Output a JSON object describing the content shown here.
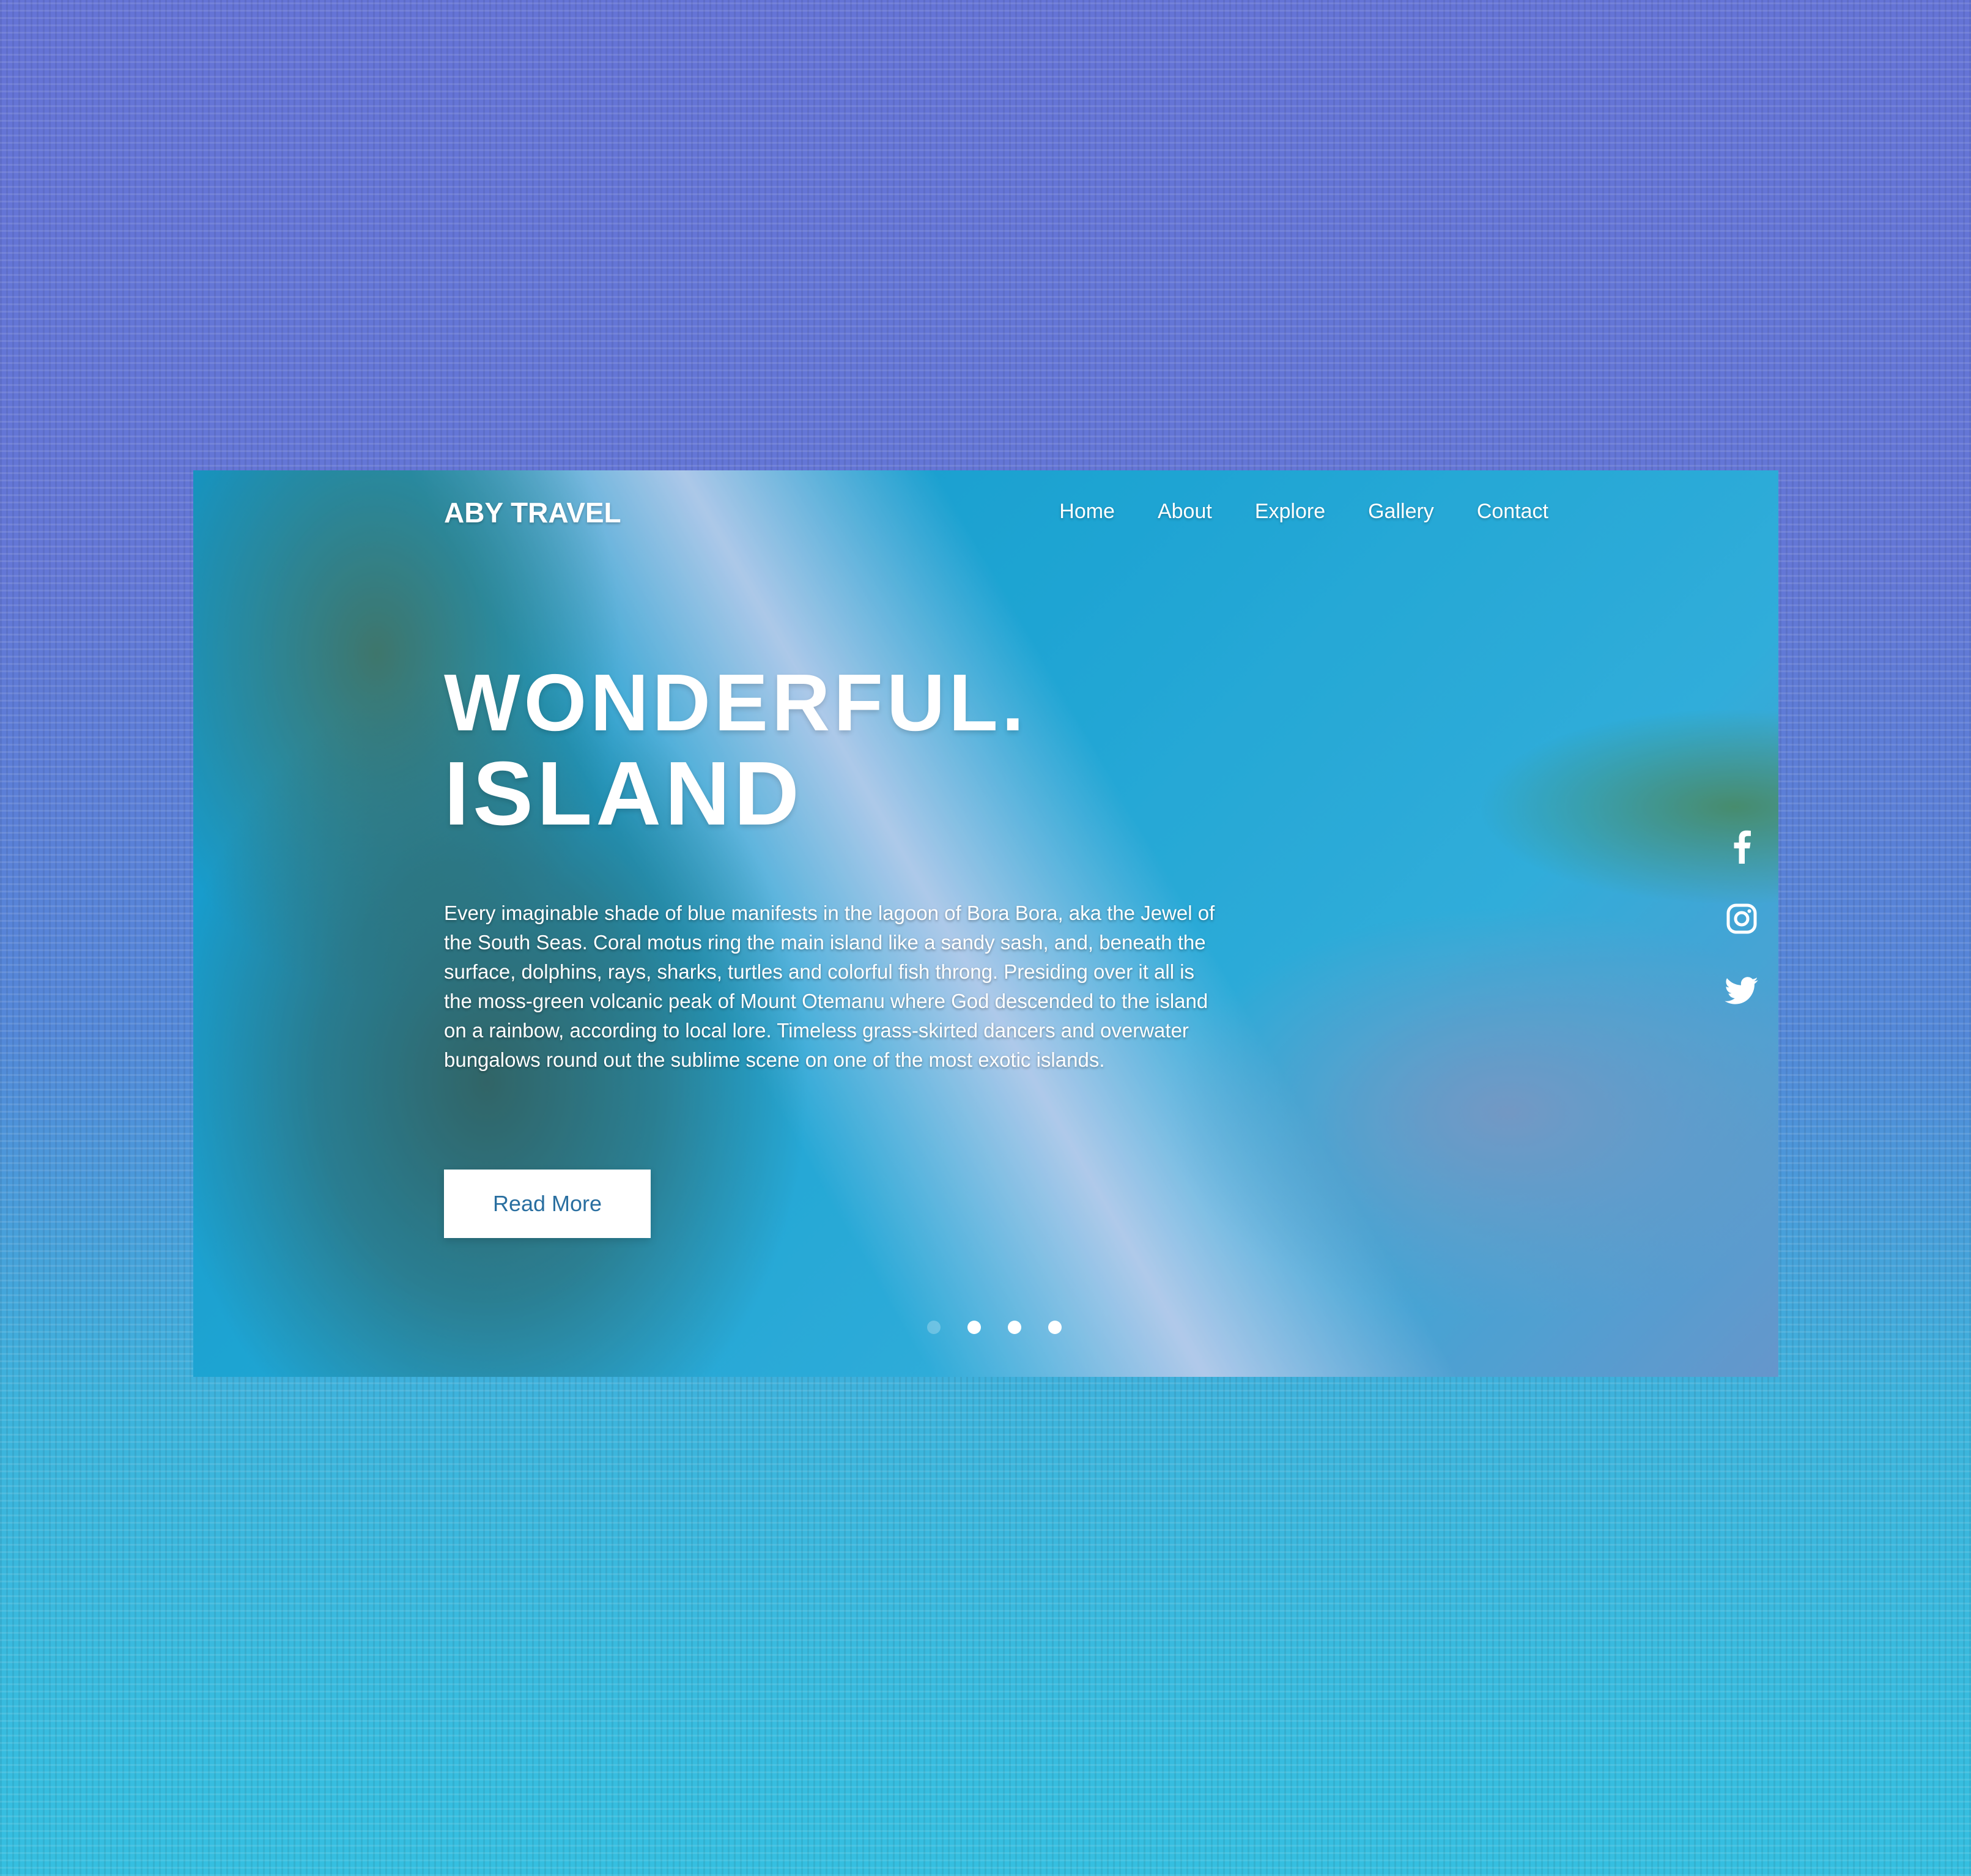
{
  "brand": "ABY TRAVEL",
  "nav": {
    "items": [
      "Home",
      "About",
      "Explore",
      "Gallery",
      "Contact"
    ]
  },
  "hero": {
    "title_line1": "WONDERFUL.",
    "title_line2": "ISLAND",
    "description": "Every imaginable shade of blue manifests in the lagoon of Bora Bora, aka the Jewel of the South Seas. Coral motus ring the main island like a sandy sash, and, beneath the surface, dolphins, rays, sharks, turtles and colorful fish throng. Presiding over it all is the moss-green volcanic peak of Mount Otemanu where God descended to the island on a rainbow, according to local lore. Timeless grass-skirted dancers and overwater bungalows round out the sublime scene on one of the most exotic islands.",
    "button_label": "Read More"
  },
  "social": {
    "icons": [
      "facebook-icon",
      "instagram-icon",
      "twitter-icon"
    ]
  },
  "slider": {
    "count": 4,
    "active_index": 0
  },
  "colors": {
    "background_top": "#6574d6",
    "background_bottom": "#35bfe0",
    "button_text": "#2a6fa0",
    "text": "#ffffff"
  }
}
